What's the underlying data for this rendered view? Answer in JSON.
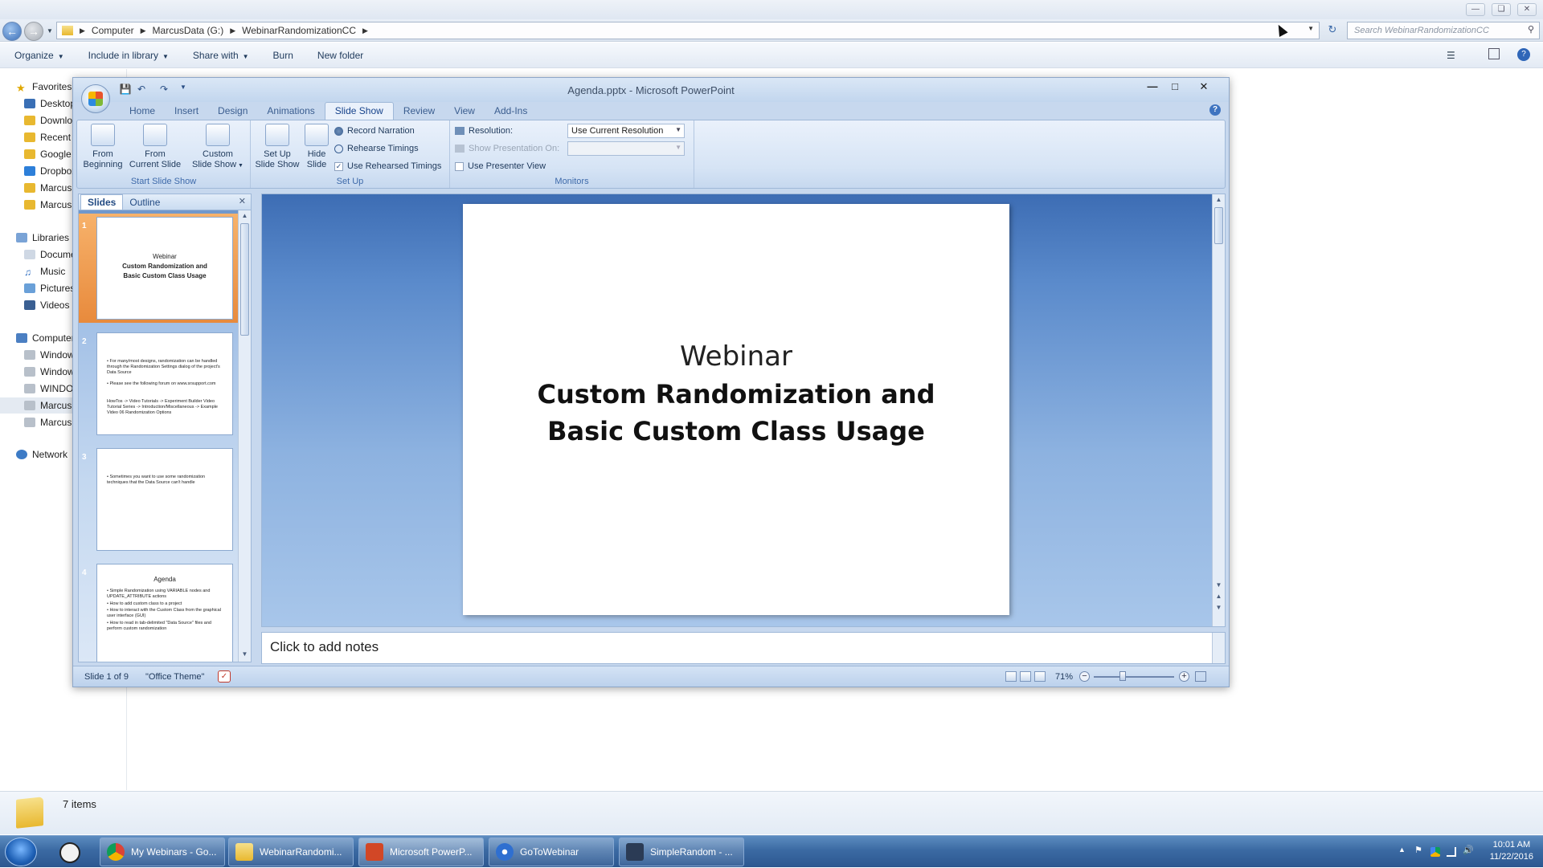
{
  "explorer": {
    "address": {
      "crumbs": [
        "Computer",
        "MarcusData (G:)",
        "WebinarRandomizationCC"
      ]
    },
    "search_placeholder": "Search WebinarRandomizationCC",
    "toolbar": {
      "organize": "Organize",
      "include_in_library": "Include in library",
      "share_with": "Share with",
      "burn": "Burn",
      "new_folder": "New folder"
    },
    "nav": {
      "favorites": "Favorites",
      "favorites_items": [
        "Desktop",
        "Downloads",
        "Recent",
        "Google",
        "Dropbox",
        "Marcus",
        "Marcus"
      ],
      "libraries": "Libraries",
      "libraries_items": [
        "Documents",
        "Music",
        "Pictures",
        "Videos"
      ],
      "computer": "Computer",
      "computer_items": [
        "Windows",
        "Windows",
        "WINDOWS",
        "Marcus",
        "Marcus"
      ],
      "network": "Network"
    },
    "status_items": "7 items"
  },
  "ppt": {
    "title": "Agenda.pptx - Microsoft PowerPoint",
    "tabs": [
      "Home",
      "Insert",
      "Design",
      "Animations",
      "Slide Show",
      "Review",
      "View",
      "Add-Ins"
    ],
    "active_tab": "Slide Show",
    "ribbon": {
      "start_group": {
        "label": "Start Slide Show",
        "from_beginning": [
          "From",
          "Beginning"
        ],
        "from_current": [
          "From",
          "Current Slide"
        ],
        "custom": [
          "Custom",
          "Slide Show"
        ]
      },
      "setup_group": {
        "label": "Set Up",
        "setup_show": [
          "Set Up",
          "Slide Show"
        ],
        "hide_slide": [
          "Hide",
          "Slide"
        ],
        "record_narration": "Record Narration",
        "rehearse_timings": "Rehearse Timings",
        "use_rehearsed": "Use Rehearsed Timings"
      },
      "monitors_group": {
        "label": "Monitors",
        "resolution_label": "Resolution:",
        "resolution_value": "Use Current Resolution",
        "show_on_label": "Show Presentation On:",
        "presenter_view": "Use Presenter View"
      }
    },
    "pane_tabs": {
      "slides": "Slides",
      "outline": "Outline"
    },
    "thumbs": [
      {
        "num": "1",
        "lines": [
          "Webinar",
          "Custom Randomization  and",
          "Basic Custom Class Usage"
        ]
      },
      {
        "num": "2",
        "lines": [
          "• For many/most designs, randomization can be handled through the Randomization Settings dialog of the project's Data Source",
          "• Please see the following forum on www.srsupport.com",
          "HowTos -> Video Tutorials -> Experiment Builder Video Tutorial Series -> Introduction/Miscellaneous -> Example Video 06 Randomization Options"
        ]
      },
      {
        "num": "3",
        "lines": [
          "• Sometimes you want to use some randomization techniques that the Data Source can't handle"
        ]
      },
      {
        "num": "4",
        "lines": [
          "Agenda",
          "• Simple Randomization using VARIABLE nodes and UPDATE_ATTRIBUTE actions",
          "• How to add custom class to a project",
          "• How to interact with the Custom Class from the graphical user interface (GUI)",
          "• How to read in tab-delimited \"Data Source\" files and perform custom randomization"
        ]
      }
    ],
    "slide": {
      "line1": "Webinar",
      "line2": "Custom Randomization and",
      "line3": "Basic Custom Class Usage"
    },
    "notes_placeholder": "Click to add notes",
    "status": {
      "slide_of": "Slide 1 of 9",
      "theme": "\"Office Theme\"",
      "zoom": "71%"
    }
  },
  "taskbar": {
    "buttons": [
      "My Webinars - Go...",
      "WebinarRandomi...",
      "Microsoft PowerP...",
      "GoToWebinar",
      "SimpleRandom - ..."
    ],
    "time": "10:01 AM",
    "date": "11/22/2016"
  },
  "colors": {
    "taskbar": "#3b6aa3",
    "ribbon": "#d6e4f5",
    "slide_bg": "#5a8acb",
    "thumb_selection": "#f0a45a"
  }
}
